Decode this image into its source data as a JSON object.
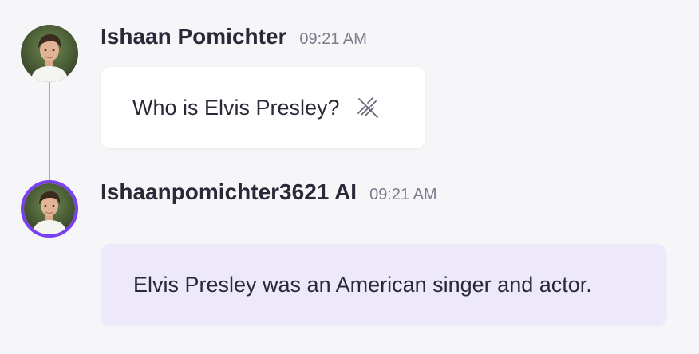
{
  "messages": [
    {
      "sender": "Ishaan Pomichter",
      "time": "09:21 AM",
      "text": "Who is Elvis Presley?",
      "action_icon": "speaker-muted-icon",
      "avatar_icon": "user-avatar-photo"
    },
    {
      "sender": "Ishaanpomichter3621 AI",
      "time": "09:21 AM",
      "text": "Elvis Presley was an American singer and actor.",
      "avatar_icon": "ai-avatar-photo",
      "accent_color": "#7b3ff2"
    }
  ],
  "colors": {
    "background": "#f6f6f9",
    "user_bubble": "#ffffff",
    "ai_bubble": "#ede9fb",
    "ai_ring": "#7b3ff2",
    "thread_line": "#a9a7c4"
  }
}
